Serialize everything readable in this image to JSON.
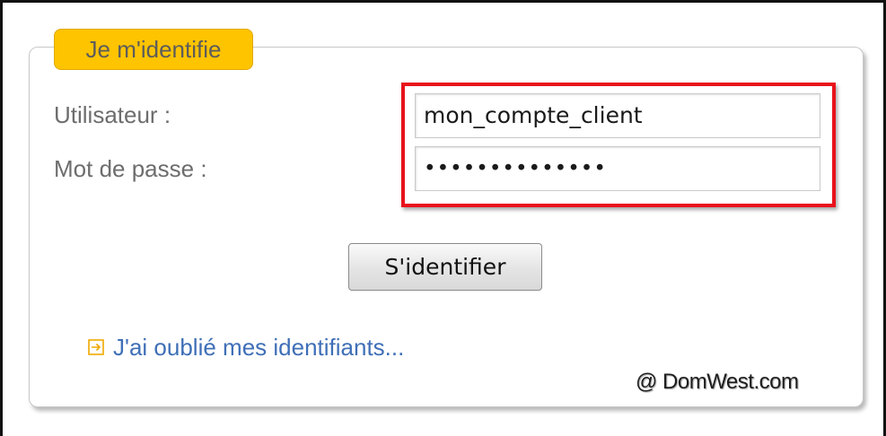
{
  "login": {
    "legend": "Je m'identifie",
    "username_label": "Utilisateur :",
    "username_value": "mon_compte_client",
    "password_label": "Mot de passe :",
    "password_value": "••••••••••••••",
    "submit_label": "S'identifier",
    "forgot_link": "J'ai oublié mes identifiants...",
    "forgot_icon": "arrow-box-icon"
  },
  "watermark": "@ DomWest.com",
  "colors": {
    "legend_background": "#ffc400",
    "highlight_border": "#e8121c",
    "link": "#3f6fb7"
  }
}
